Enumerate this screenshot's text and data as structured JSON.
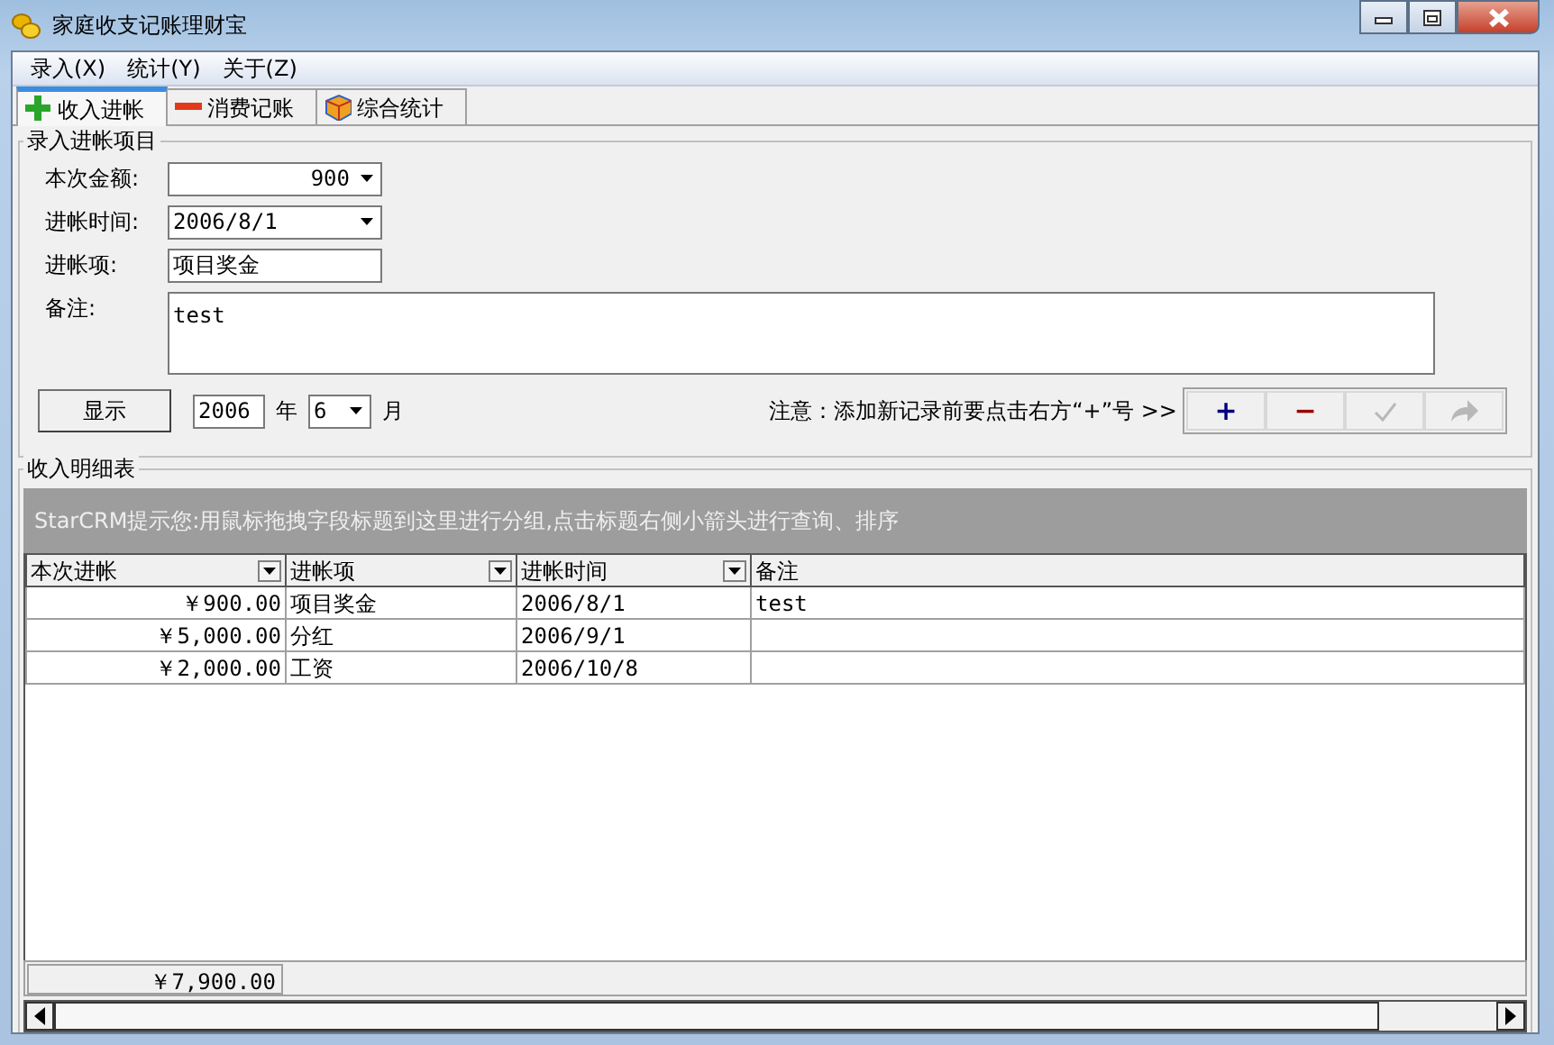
{
  "window": {
    "title": "家庭收支记账理财宝"
  },
  "menu": [
    {
      "label": "录入(X)"
    },
    {
      "label": "统计(Y)"
    },
    {
      "label": "关于(Z)"
    }
  ],
  "tabs": [
    {
      "label": "收入进帐",
      "kind": "plus",
      "selected": true
    },
    {
      "label": "消费记账",
      "kind": "minus",
      "selected": false
    },
    {
      "label": "综合统计",
      "kind": "cube",
      "selected": false
    }
  ],
  "entry_group": {
    "title": "录入进帐项目",
    "amount": {
      "label": "本次金额:",
      "value": "900"
    },
    "date": {
      "label": "进帐时间:",
      "value": "2006/8/1"
    },
    "item": {
      "label": "进帐项:",
      "value": "项目奖金"
    },
    "note": {
      "label": "备注:",
      "value": "test"
    },
    "show_button": "显示",
    "year": {
      "value": "2006",
      "label": "年"
    },
    "month": {
      "value": "6",
      "label": "月"
    },
    "notice": "注意：添加新记录前要点击右方“+”号 >>",
    "toolbar": [
      {
        "kind": "text",
        "label": "+",
        "color": "#00007f",
        "disabled": false
      },
      {
        "kind": "text",
        "label": "−",
        "color": "#9b0000",
        "disabled": false
      },
      {
        "kind": "check",
        "disabled": true
      },
      {
        "kind": "redo",
        "disabled": true
      }
    ]
  },
  "detail_group": {
    "title": "收入明细表",
    "group_hint": "StarCRM提示您:用鼠标拖拽字段标题到这里进行分组,点击标题右侧小箭头进行查询、排序",
    "columns": [
      {
        "label": "本次进帐",
        "filter_button": true
      },
      {
        "label": "进帐项",
        "filter_button": true
      },
      {
        "label": "进帐时间",
        "filter_button": true
      },
      {
        "label": "备注",
        "filter_button": false
      }
    ],
    "rows": [
      [
        "￥900.00",
        "项目奖金",
        "2006/8/1",
        "test"
      ],
      [
        "￥5,000.00",
        "分红",
        "2006/9/1",
        ""
      ],
      [
        "￥2,000.00",
        "工资",
        "2006/10/8",
        ""
      ]
    ],
    "total": "￥7,900.00"
  }
}
